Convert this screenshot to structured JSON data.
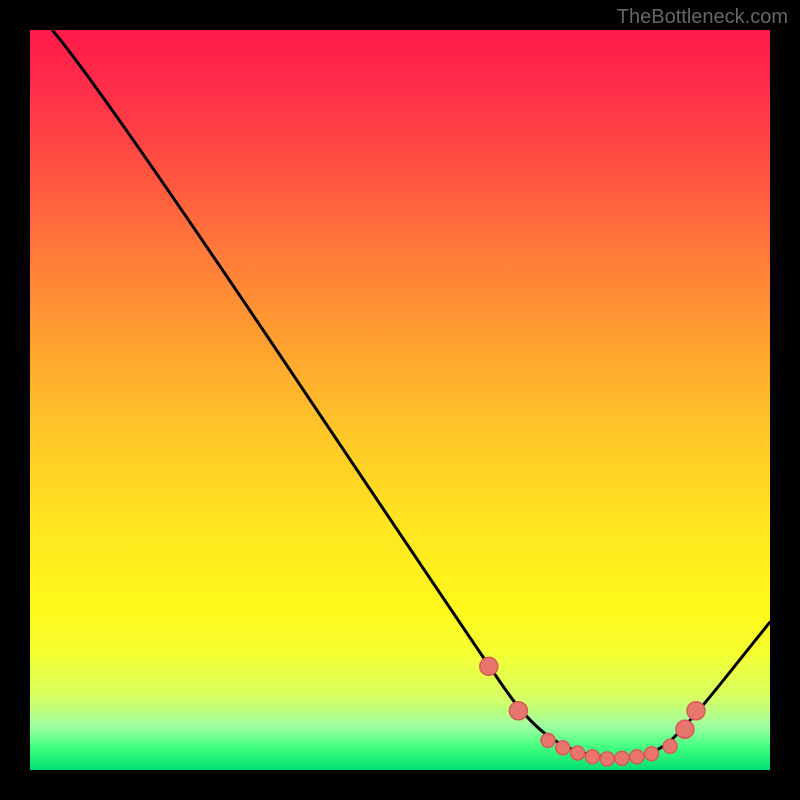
{
  "watermark": "TheBottleneck.com",
  "chart_data": {
    "type": "line",
    "title": "",
    "xlabel": "",
    "ylabel": "",
    "xlim": [
      0,
      100
    ],
    "ylim": [
      0,
      100
    ],
    "gradient_colors": {
      "top": "#ff1a4a",
      "mid": "#fff81a",
      "bottom": "#00e070"
    },
    "curve": {
      "name": "bottleneck-curve",
      "points": [
        {
          "x": 3,
          "y": 100
        },
        {
          "x": 9,
          "y": 93
        },
        {
          "x": 62,
          "y": 14
        },
        {
          "x": 67,
          "y": 7
        },
        {
          "x": 72,
          "y": 3
        },
        {
          "x": 78,
          "y": 1.5
        },
        {
          "x": 84,
          "y": 2
        },
        {
          "x": 88,
          "y": 5
        },
        {
          "x": 100,
          "y": 20
        }
      ]
    },
    "markers": [
      {
        "x": 62,
        "y": 14,
        "r": 9
      },
      {
        "x": 66,
        "y": 8,
        "r": 9
      },
      {
        "x": 70,
        "y": 4,
        "r": 7
      },
      {
        "x": 72,
        "y": 3,
        "r": 7
      },
      {
        "x": 74,
        "y": 2.3,
        "r": 7
      },
      {
        "x": 76,
        "y": 1.8,
        "r": 7
      },
      {
        "x": 78,
        "y": 1.5,
        "r": 7
      },
      {
        "x": 80,
        "y": 1.6,
        "r": 7
      },
      {
        "x": 82,
        "y": 1.8,
        "r": 7
      },
      {
        "x": 84,
        "y": 2.2,
        "r": 7
      },
      {
        "x": 86.5,
        "y": 3.2,
        "r": 7
      },
      {
        "x": 88.5,
        "y": 5.5,
        "r": 9
      },
      {
        "x": 90,
        "y": 8,
        "r": 9
      }
    ]
  }
}
